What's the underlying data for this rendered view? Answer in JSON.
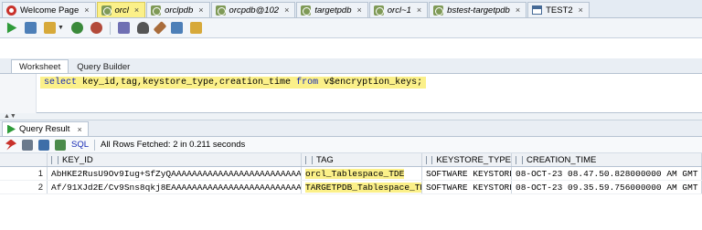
{
  "editor_tabs": [
    {
      "label": "Welcome Page",
      "icon": "home-icon",
      "active": false
    },
    {
      "label": "orcl",
      "icon": "database-connection-icon",
      "active": true
    },
    {
      "label": "orclpdb",
      "icon": "database-connection-icon",
      "active": false
    },
    {
      "label": "orcpdb@102",
      "icon": "database-connection-icon",
      "active": false
    },
    {
      "label": "targetpdb",
      "icon": "database-connection-icon",
      "active": false
    },
    {
      "label": "orcl~1",
      "icon": "database-connection-icon",
      "active": false
    },
    {
      "label": "bstest-targetpdb",
      "icon": "database-connection-icon",
      "active": false
    },
    {
      "label": "TEST2",
      "icon": "table-icon",
      "active": false
    }
  ],
  "close_glyph": "×",
  "worksheet_tabs": {
    "worksheet": "Worksheet",
    "query_builder": "Query Builder"
  },
  "editor": {
    "select_kw": "select",
    "columns": " key_id,tag,keystore_type,creation_time ",
    "from_kw": "from",
    "table": " v$encryption_keys;"
  },
  "result_tab": {
    "label": "Query Result"
  },
  "result_toolbar": {
    "sql_label": "SQL",
    "status": "All Rows Fetched: 2 in 0.211 seconds"
  },
  "grid": {
    "headers": [
      "KEY_ID",
      "TAG",
      "KEYSTORE_TYPE",
      "CREATION_TIME"
    ],
    "rows": [
      {
        "n": "1",
        "key_id": "AbHKE2RusU9Ov9Iug+SfZyQAAAAAAAAAAAAAAAAAAAAAAAAAAAAAAA",
        "tag": "orcl_Tablespace_TDE",
        "keystore_type": "SOFTWARE KEYSTORE",
        "creation_time": "08-OCT-23 08.47.50.828000000 AM GMT"
      },
      {
        "n": "2",
        "key_id": "Af/91XJd2E/Cv9Sns8qkj8EAAAAAAAAAAAAAAAAAAAAAAAAAAAAAAA",
        "tag": "TARGETPDB_Tablespace_TDE",
        "keystore_type": "SOFTWARE KEYSTORE",
        "creation_time": "08-OCT-23 09.35.59.756000000 AM GMT"
      }
    ]
  },
  "colors": {
    "highlight": "#fbf089",
    "keyword": "#1428b4"
  }
}
